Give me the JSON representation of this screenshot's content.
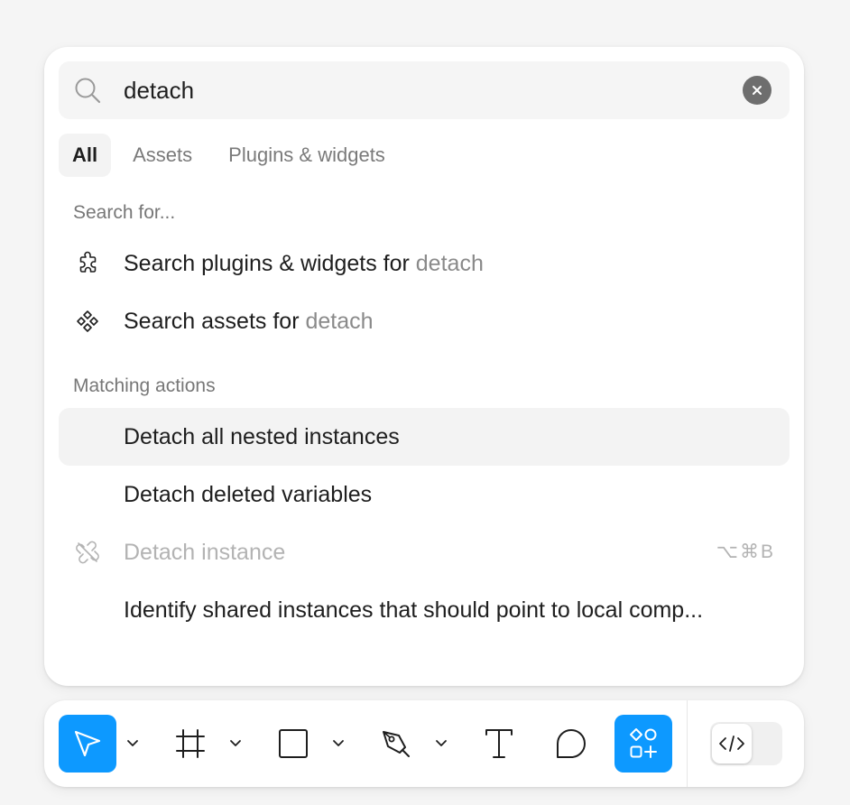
{
  "search": {
    "value": "detach",
    "icon": "search-icon",
    "clear_icon": "close-icon"
  },
  "tabs": [
    {
      "label": "All",
      "active": true
    },
    {
      "label": "Assets",
      "active": false
    },
    {
      "label": "Plugins & widgets",
      "active": false
    }
  ],
  "search_for": {
    "heading": "Search for...",
    "items": [
      {
        "prefix": "Search plugins & widgets for ",
        "query": "detach",
        "icon": "plugin-icon"
      },
      {
        "prefix": "Search assets for ",
        "query": "detach",
        "icon": "assets-icon"
      }
    ]
  },
  "matching_actions": {
    "heading": "Matching actions",
    "items": [
      {
        "label": "Detach all nested instances",
        "highlighted": true
      },
      {
        "label": "Detach deleted variables"
      },
      {
        "label": "Detach instance",
        "disabled": true,
        "shortcut": "⌥⌘B",
        "icon": "detach-instance-icon"
      },
      {
        "label": "Identify shared instances that should point to local comp..."
      }
    ]
  },
  "toolbar": {
    "tools": [
      {
        "name": "move-tool",
        "icon": "cursor-icon",
        "active": true
      },
      {
        "name": "frame-tool",
        "icon": "frame-icon"
      },
      {
        "name": "shape-tool",
        "icon": "rectangle-icon"
      },
      {
        "name": "pen-tool",
        "icon": "pen-icon"
      },
      {
        "name": "text-tool",
        "icon": "text-icon"
      },
      {
        "name": "comment-tool",
        "icon": "comment-icon"
      },
      {
        "name": "actions-tool",
        "icon": "actions-icon",
        "active": true
      }
    ],
    "dev_mode_icon": "code-icon"
  },
  "colors": {
    "accent": "#0d99ff",
    "text": "#1e1e1e",
    "muted": "#8a8a8a",
    "disabled": "#b3b3b3",
    "highlight": "#f3f3f3"
  }
}
